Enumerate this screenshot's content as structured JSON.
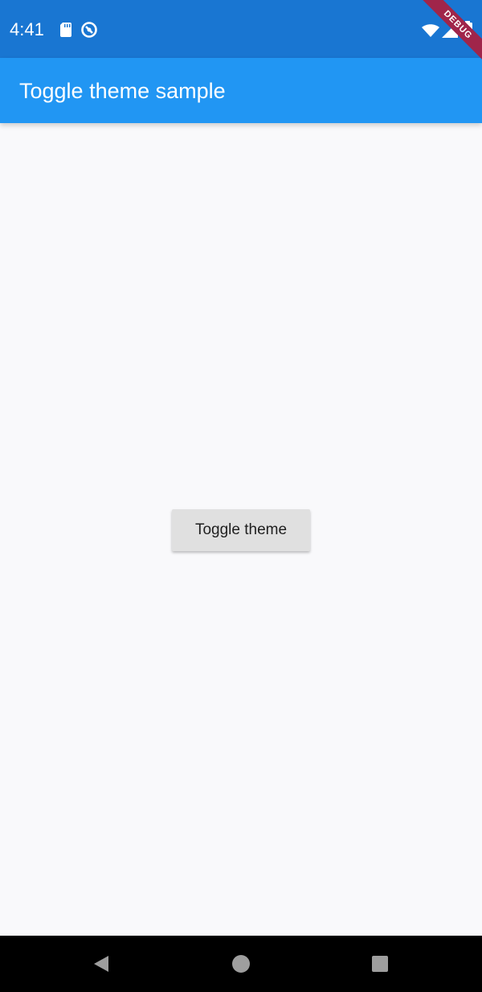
{
  "status_bar": {
    "time": "4:41",
    "background_color": "#1976d2",
    "icons": [
      "sd-card-icon",
      "sync-icon",
      "wifi-icon",
      "signal-icon",
      "battery-icon"
    ]
  },
  "debug_banner": {
    "label": "DEBUG",
    "color": "#a0254a"
  },
  "app_bar": {
    "title": "Toggle theme sample",
    "background_color": "#2196f3"
  },
  "main": {
    "toggle_button_label": "Toggle theme"
  },
  "nav_bar": {
    "icons": [
      "back-icon",
      "home-icon",
      "recents-icon"
    ],
    "background_color": "#000000"
  }
}
